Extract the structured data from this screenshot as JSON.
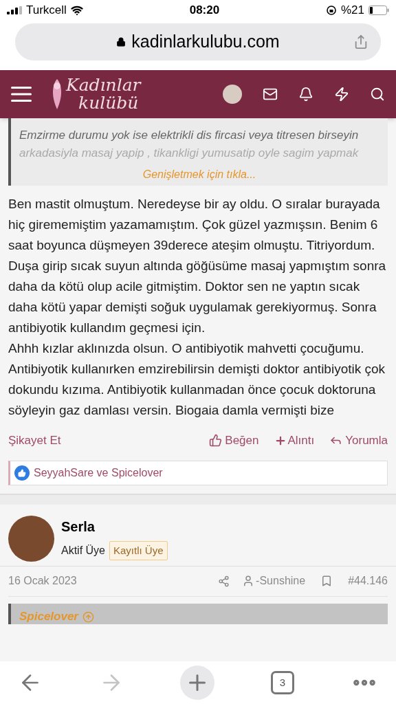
{
  "status_bar": {
    "carrier": "Turkcell",
    "time": "08:20",
    "battery": "%21"
  },
  "address_bar": {
    "url": "kadinlarkulubu.com"
  },
  "site_header": {
    "logo_line_1": "Kadınlar",
    "logo_line_2": "kulübü"
  },
  "quote": {
    "lines": [
      "Emzirme durumu yok ise elektrikli dis fircasi veya titresen birseyin",
      "arkadasiyla masaj yapip , tikankligi yumusatip oyle sagim yapmak"
    ],
    "expand": "Genişletmek için tıkla..."
  },
  "post_body": [
    "Ben mastit olmuştum. Neredeyse bir ay oldu. O sıralar burayada hiç girememiştim yazamamıştım. Çok güzel yazmışsın. Benim 6 saat boyunca düşmeyen 39derece ateşim olmuştu. Titriyordum. Duşa girip sıcak suyun altında göğüsüme masaj yapmıştım sonra daha da kötü olup acile gitmiştim. Doktor sen ne yaptın sıcak daha kötü yapar demişti soğuk uygulamak gerekiyormuş. Sonra antibiyotik kullandım geçmesi için.",
    "Ahhh kızlar aklınızda olsun. O antibiyotik mahvetti çocuğumu. Antibiyotik kullanırken emzirebilirsin demişti doktor antibiyotik çok dokundu kızıma. Antibiyotik kullanmadan önce çocuk doktoruna söyleyin gaz damlası versin. Biogaia damla vermişti bize"
  ],
  "post_actions": {
    "report": "Şikayet Et",
    "like": "Beğen",
    "quote": "Alıntı",
    "reply": "Yorumla"
  },
  "reactions": "SeyyahSare ve Spicelover",
  "next_post": {
    "username": "Serla",
    "title": "Aktif Üye",
    "badge": "Kayıtlı Üye",
    "date": "16 Ocak 2023",
    "author_tag": "-Sunshine",
    "post_number": "#44.146",
    "quote_author": "Spicelover"
  },
  "toolbar": {
    "tab_count": "3"
  }
}
